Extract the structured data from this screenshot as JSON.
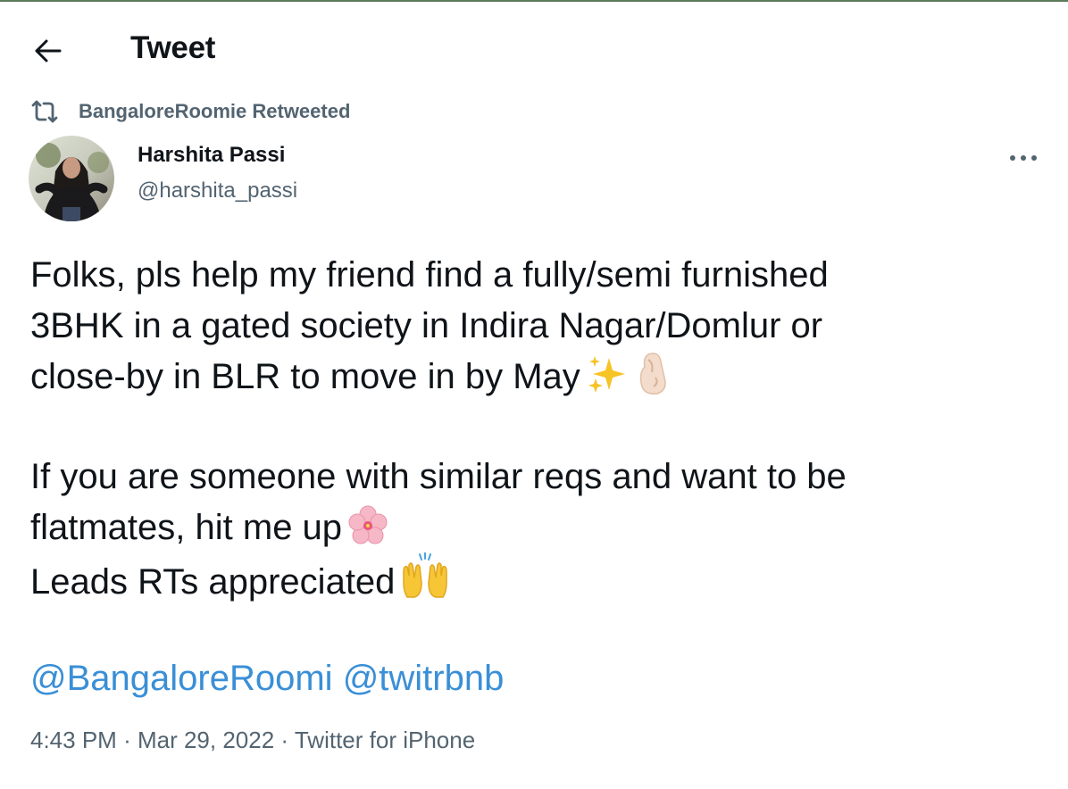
{
  "header": {
    "title": "Tweet"
  },
  "retweet_context": {
    "text": "BangaloreRoomie Retweeted"
  },
  "author": {
    "name": "Harshita Passi",
    "handle": "@harshita_passi"
  },
  "tweet": {
    "lines": [
      "Folks, pls help my friend find a fully/semi furnished",
      "3BHK in a gated society in Indira Nagar/Domlur or",
      "close-by in BLR to move in by May"
    ],
    "paragraph2_lines": [
      "If you are someone with similar reqs and want to be",
      "flatmates, hit me up"
    ],
    "line_leads": "Leads RTs appreciated",
    "mentions": [
      "@BangaloreRoomi",
      "@twitrbnb"
    ]
  },
  "meta": {
    "time": "4:43 PM",
    "separator": "·",
    "date": "Mar 29, 2022",
    "source": "Twitter for iPhone"
  },
  "icons": {
    "back": "arrow-left-icon",
    "retweet": "retweet-icon",
    "more": "more-horizontal-icon",
    "sparkles": "sparkles-emoji",
    "pinched": "pinched-fingers-emoji",
    "blossom": "cherry-blossom-emoji",
    "raised_hands": "raising-hands-emoji"
  },
  "colors": {
    "text": "#0f1419",
    "secondary": "#536471",
    "link": "#3a8fd6"
  }
}
